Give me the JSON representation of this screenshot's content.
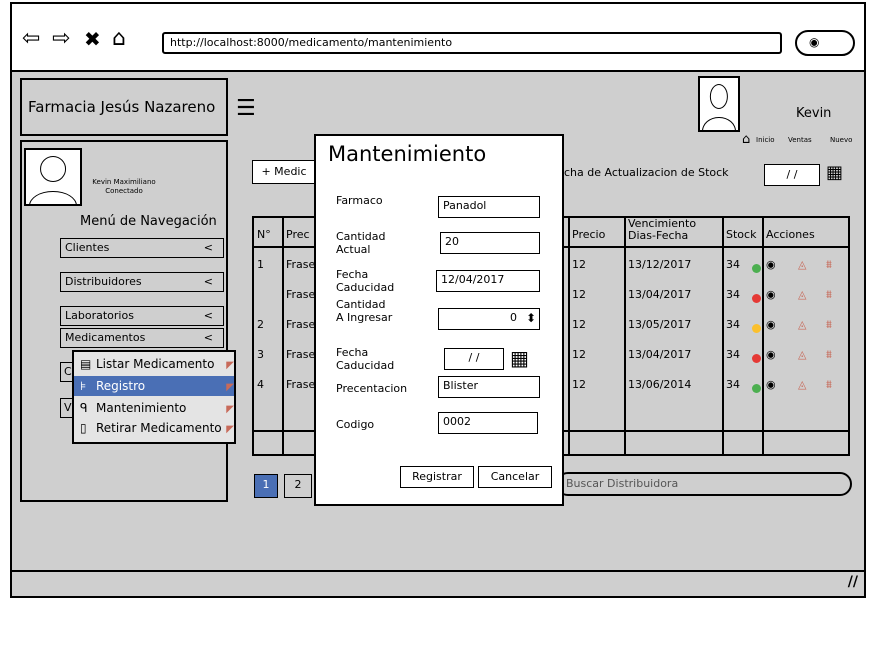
{
  "browser": {
    "url": "http://localhost:8000/medicamento/mantenimiento",
    "icons": [
      "back-arrow-icon",
      "forward-arrow-icon",
      "close-icon",
      "home-icon",
      "search-icon"
    ]
  },
  "header": {
    "brand": "Farmacia Jesús Nazareno",
    "user_name": "Kevin",
    "breadcrumb": [
      "Inicio",
      "Ventas",
      "Nuevo"
    ]
  },
  "sidebar": {
    "user_name": "Kevin Maximiliano",
    "user_status": "Conectado",
    "menu_title": "Menú de Navegación",
    "items": [
      {
        "label": "Clientes",
        "chevron": "<"
      },
      {
        "label": "Distribuidores",
        "chevron": "<"
      },
      {
        "label": "Laboratorios",
        "chevron": "<"
      },
      {
        "label": "Medicamentos",
        "chevron": "<"
      }
    ],
    "fragments": [
      "C",
      "V"
    ],
    "dropdown": [
      {
        "icon": "list-icon",
        "label": "Listar Medicamento"
      },
      {
        "icon": "cart-icon",
        "label": "Registro"
      },
      {
        "icon": "search-icon",
        "label": "Mantenimiento"
      },
      {
        "icon": "file-icon",
        "label": "Retirar Medicamento"
      }
    ],
    "selected_dropdown": "Registro"
  },
  "main": {
    "add_button": "+ Medic",
    "update_label": "cha de Actualizacion de Stock",
    "date_field": "/ /",
    "table": {
      "headers": [
        "N°",
        "Prec",
        "Precio",
        "Vencimiento Dias-Fecha",
        "Stock",
        "Acciones"
      ],
      "rows": [
        {
          "n": "1",
          "prec": "Frase",
          "precio": "12",
          "vencimiento": "13/12/2017",
          "stock": "34",
          "status": "green"
        },
        {
          "n": "",
          "prec": "Frase",
          "precio": "12",
          "vencimiento": "13/04/2017",
          "stock": "34",
          "status": "red"
        },
        {
          "n": "2",
          "prec": "Frase",
          "precio": "12",
          "vencimiento": "13/05/2017",
          "stock": "34",
          "status": "yellow"
        },
        {
          "n": "3",
          "prec": "Frase",
          "precio": "12",
          "vencimiento": "13/04/2017",
          "stock": "34",
          "status": "red"
        },
        {
          "n": "4",
          "prec": "Frase",
          "precio": "12",
          "vencimiento": "13/06/2014",
          "stock": "34",
          "status": "green"
        }
      ]
    },
    "pager": [
      "1",
      "2"
    ],
    "search_placeholder": "Buscar Distribuidora"
  },
  "modal": {
    "title": "Mantenimiento",
    "farmaco_label": "Farmaco",
    "farmaco_value": "Panadol",
    "cantidad_actual_label": "Cantidad\nActual",
    "cantidad_actual_value": "20",
    "fecha_caducidad_label": "Fecha\nCaducidad",
    "fecha_caducidad_value": "12/04/2017",
    "cantidad_ingresar_label": "Cantidad\nA Ingresar",
    "cantidad_ingresar_value": "0",
    "fecha_caducidad2_label": "Fecha\nCaducidad",
    "fecha_caducidad2_value": "/ /",
    "presentacion_label": "Precentacion",
    "presentacion_value": "Blister",
    "codigo_label": "Codigo",
    "codigo_value": "0002",
    "registrar": "Registrar",
    "cancelar": "Cancelar"
  },
  "colors": {
    "app_bg": "#cfcfcf",
    "selection": "#4a6fb5",
    "green": "#4caf50",
    "red": "#e53935",
    "yellow": "#fbc02d",
    "action_icon": "#c86a5a"
  }
}
